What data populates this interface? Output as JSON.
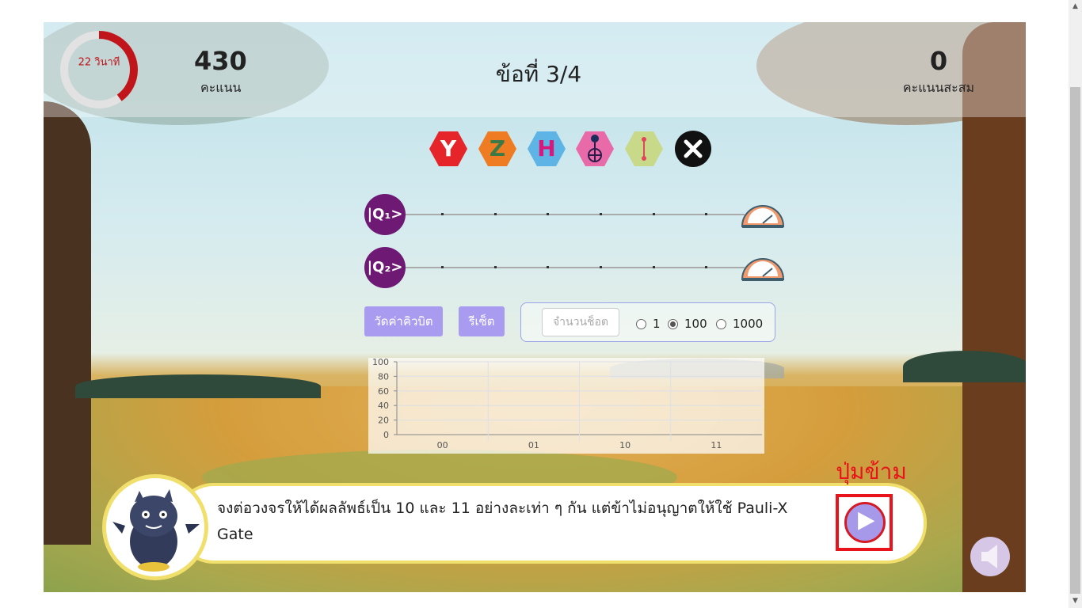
{
  "header": {
    "timer_label": "22 วินาที",
    "timer_remaining_fraction": 0.4,
    "score_value": "430",
    "score_label": "คะแนน",
    "question_title": "ข้อที่ 3/4",
    "total_value": "0",
    "total_label": "คะแนนสะสม"
  },
  "gates": [
    {
      "name": "Y",
      "color": "#e5252a",
      "text_color": "#ffffff"
    },
    {
      "name": "Z",
      "color": "#ef7b22",
      "text_color": "#3b7a46"
    },
    {
      "name": "H",
      "color": "#5fb4e6",
      "text_color": "#d8187b"
    },
    {
      "name": "control-target",
      "color": "#e86aa9"
    },
    {
      "name": "swap",
      "color": "#c8d98a"
    },
    {
      "name": "close",
      "color": "#111111"
    }
  ],
  "circuit": {
    "qubits": [
      {
        "label": "|Q₁>"
      },
      {
        "label": "|Q₂>"
      }
    ]
  },
  "controls": {
    "measure_label": "วัดค่าคิวบิต",
    "reset_label": "รีเซ็ต",
    "shots_placeholder": "จำนวนช็อต",
    "shot_options": [
      "1",
      "100",
      "1000"
    ],
    "selected_shot": "100"
  },
  "chart_data": {
    "type": "bar",
    "categories": [
      "00",
      "01",
      "10",
      "11"
    ],
    "values": [
      0,
      0,
      0,
      0
    ],
    "ylim": [
      0,
      100
    ],
    "yticks": [
      "100",
      "80",
      "60",
      "40",
      "20",
      "0"
    ],
    "grid": true
  },
  "dialog": {
    "text": "จงต่อวงจรให้ได้ผลลัพธ์เป็น 10 และ 11 อย่างละเท่า ๆ กัน แต่ข้าไม่อนุญาตให้ใช้ Pauli-X Gate",
    "skip_label": "ปุ่มข้าม"
  }
}
